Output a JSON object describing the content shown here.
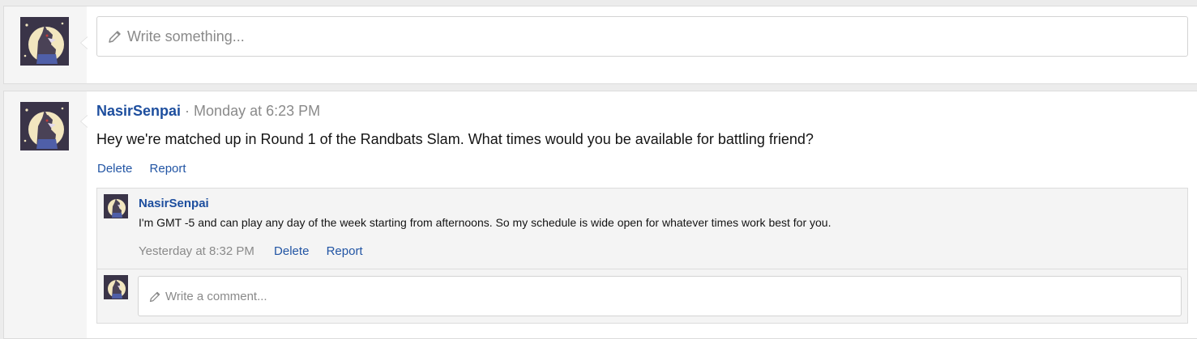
{
  "status_box": {
    "placeholder": "Write something..."
  },
  "post": {
    "author": "NasirSenpai",
    "separator": " · ",
    "time": "Monday at 6:23 PM",
    "message": "Hey we're matched up in Round 1 of the Randbats Slam. What times would you be available for battling friend?",
    "actions": {
      "delete": "Delete",
      "report": "Report"
    }
  },
  "comment": {
    "author": "NasirSenpai",
    "message": "I'm GMT -5 and can play any day of the week starting from afternoons. So my schedule is wide open for whatever times work best for you.",
    "time": "Yesterday at 8:32 PM",
    "actions": {
      "delete": "Delete",
      "report": "Report"
    }
  },
  "comment_box": {
    "placeholder": "Write a comment..."
  },
  "icons": {
    "avatar": "avatar-moon-character",
    "pencil": "pencil-icon"
  },
  "colors": {
    "link": "#2255a4",
    "username": "#1d4e9e",
    "muted": "#8a8a8a"
  }
}
